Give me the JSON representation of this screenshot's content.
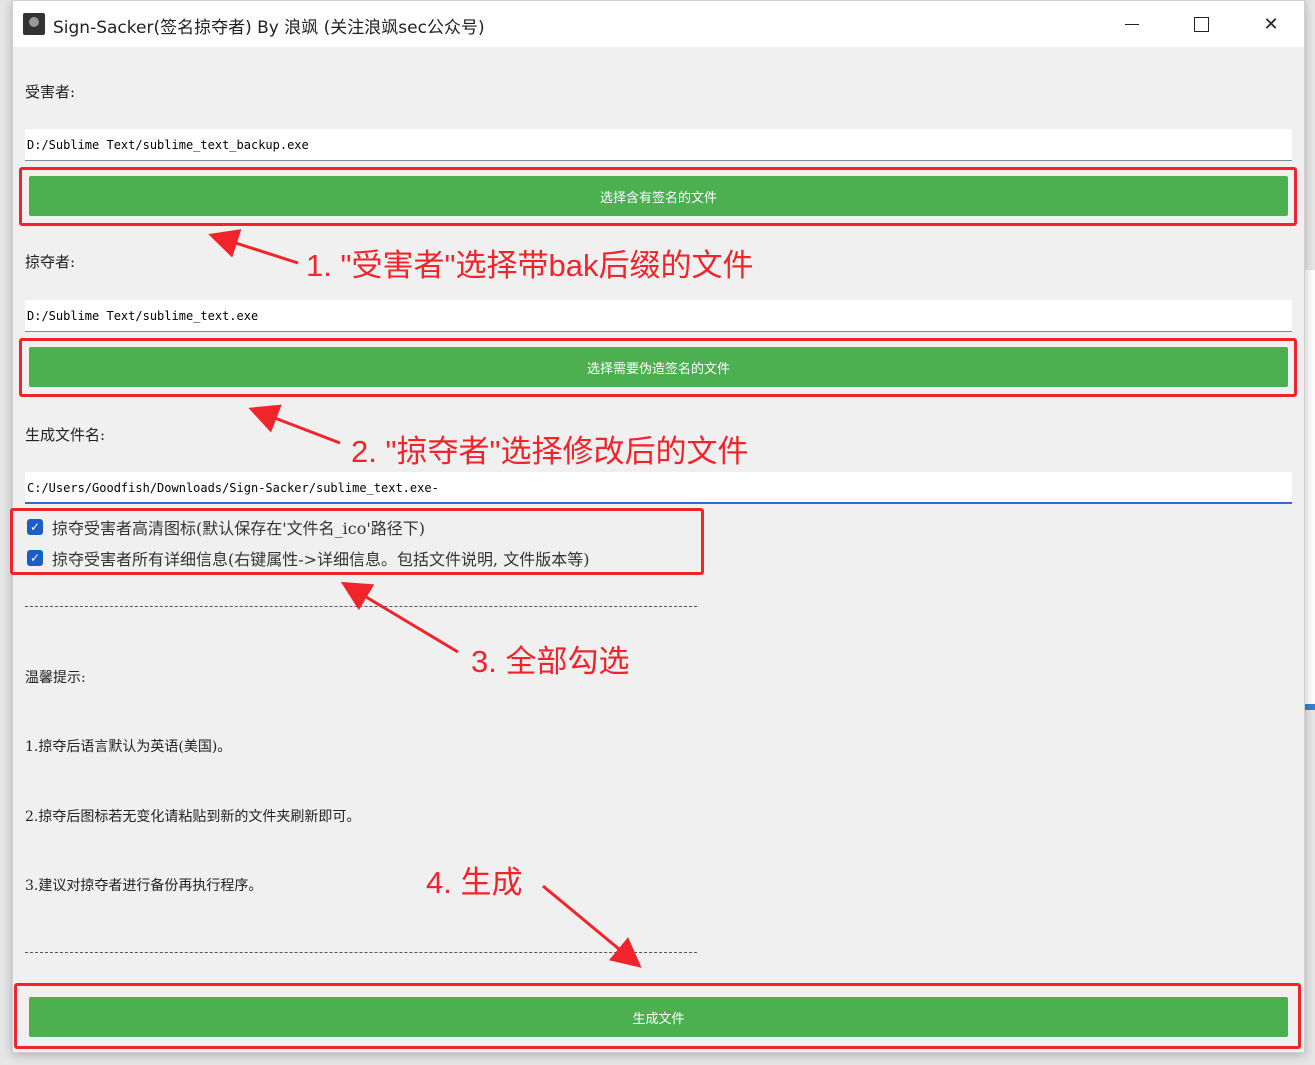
{
  "window": {
    "title": "Sign-Sacker(签名掠夺者) By 浪飒 (关注浪飒sec公众号)",
    "controls": {
      "minimize": "—",
      "maximize": "□",
      "close": "✕"
    }
  },
  "victim": {
    "label": "受害者:",
    "path": "D:/Sublime Text/sublime_text_backup.exe",
    "button": "选择含有签名的文件"
  },
  "plunderer": {
    "label": "掠夺者:",
    "path": "D:/Sublime Text/sublime_text.exe",
    "button": "选择需要伪造签名的文件"
  },
  "output": {
    "label": "生成文件名:",
    "path": "C:/Users/Goodfish/Downloads/Sign-Sacker/sublime_text.exe-"
  },
  "options": [
    {
      "label": "掠夺受害者高清图标(默认保存在'文件名_ico'路径下)",
      "checked": true
    },
    {
      "label": "掠夺受害者所有详细信息(右键属性->详细信息。包括文件说明, 文件版本等)",
      "checked": true
    }
  ],
  "separator": "----------------------------------------------------------------------------------------------------------",
  "tips": {
    "heading": "温馨提示:",
    "items": [
      "1.掠夺后语言默认为英语(美国)。",
      "2.掠夺后图标若无变化请粘贴到新的文件夹刷新即可。",
      "3.建议对掠夺者进行备份再执行程序。"
    ]
  },
  "generate_button": "生成文件",
  "annotations": {
    "step1": "1. \"受害者\"选择带bak后缀的文件",
    "step2": "2.  \"掠夺者\"选择修改后的文件",
    "step3": "3. 全部勾选",
    "step4": "4. 生成"
  },
  "colors": {
    "button_green": "#4caf50",
    "annotation_red": "#f0242a",
    "checkbox_blue": "#1a5fc8"
  }
}
